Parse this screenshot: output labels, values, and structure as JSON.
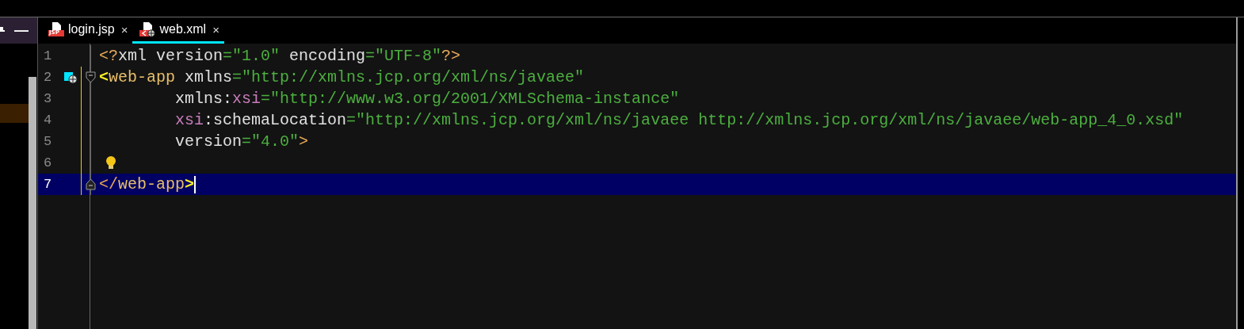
{
  "side_panel": {
    "minimize": "—"
  },
  "tabs": [
    {
      "label": "login.jsp",
      "kind": "jsp",
      "badge": "JSP",
      "close": "×",
      "selected": false
    },
    {
      "label": "web.xml",
      "kind": "xml",
      "close": "×",
      "selected": true
    }
  ],
  "editor": {
    "lines": [
      {
        "number": "1",
        "kind": "plain",
        "current": false,
        "in_scope": false,
        "tokens": [
          {
            "kind": "bracket",
            "text": "<?"
          },
          {
            "kind": "attr",
            "text": "xml version"
          },
          {
            "kind": "value",
            "text": "=\"1.0\""
          },
          {
            "kind": "attr",
            "text": " encoding"
          },
          {
            "kind": "value",
            "text": "=\"UTF-8\""
          },
          {
            "kind": "bracket",
            "text": "?>"
          }
        ]
      },
      {
        "number": "2",
        "kind": "fold-start",
        "current": false,
        "in_scope": true,
        "tokens": [
          {
            "kind": "match",
            "text": "<"
          },
          {
            "kind": "tag",
            "text": "web-app"
          },
          {
            "kind": "attr",
            "text": " xmlns"
          },
          {
            "kind": "value",
            "text": "=\"http://xmlns.jcp.org/xml/ns/javaee\""
          }
        ]
      },
      {
        "number": "3",
        "kind": "plain",
        "current": false,
        "in_scope": true,
        "tokens": [
          {
            "kind": "attr",
            "text": "        xmlns:"
          },
          {
            "kind": "ns",
            "text": "xsi"
          },
          {
            "kind": "value",
            "text": "=\"http://www.w3.org/2001/XMLSchema-instance\""
          }
        ]
      },
      {
        "number": "4",
        "kind": "plain",
        "current": false,
        "in_scope": true,
        "tokens": [
          {
            "kind": "ns",
            "text": "        xsi"
          },
          {
            "kind": "attr",
            "text": ":schemaLocation"
          },
          {
            "kind": "value",
            "text": "=\"http://xmlns.jcp.org/xml/ns/javaee http://xmlns.jcp.org/xml/ns/javaee/web-app_4_0.xsd\""
          }
        ]
      },
      {
        "number": "5",
        "kind": "plain",
        "current": false,
        "in_scope": true,
        "tokens": [
          {
            "kind": "attr",
            "text": "        version"
          },
          {
            "kind": "value",
            "text": "=\"4.0\""
          },
          {
            "kind": "bracket",
            "text": ">"
          }
        ]
      },
      {
        "number": "6",
        "kind": "hint",
        "current": false,
        "in_scope": true
      },
      {
        "number": "7",
        "kind": "fold-end",
        "current": true,
        "in_scope": true,
        "tokens": [
          {
            "kind": "bracket",
            "text": "</"
          },
          {
            "kind": "tag",
            "text": "web-app"
          },
          {
            "kind": "match",
            "text": ">"
          }
        ]
      }
    ]
  }
}
